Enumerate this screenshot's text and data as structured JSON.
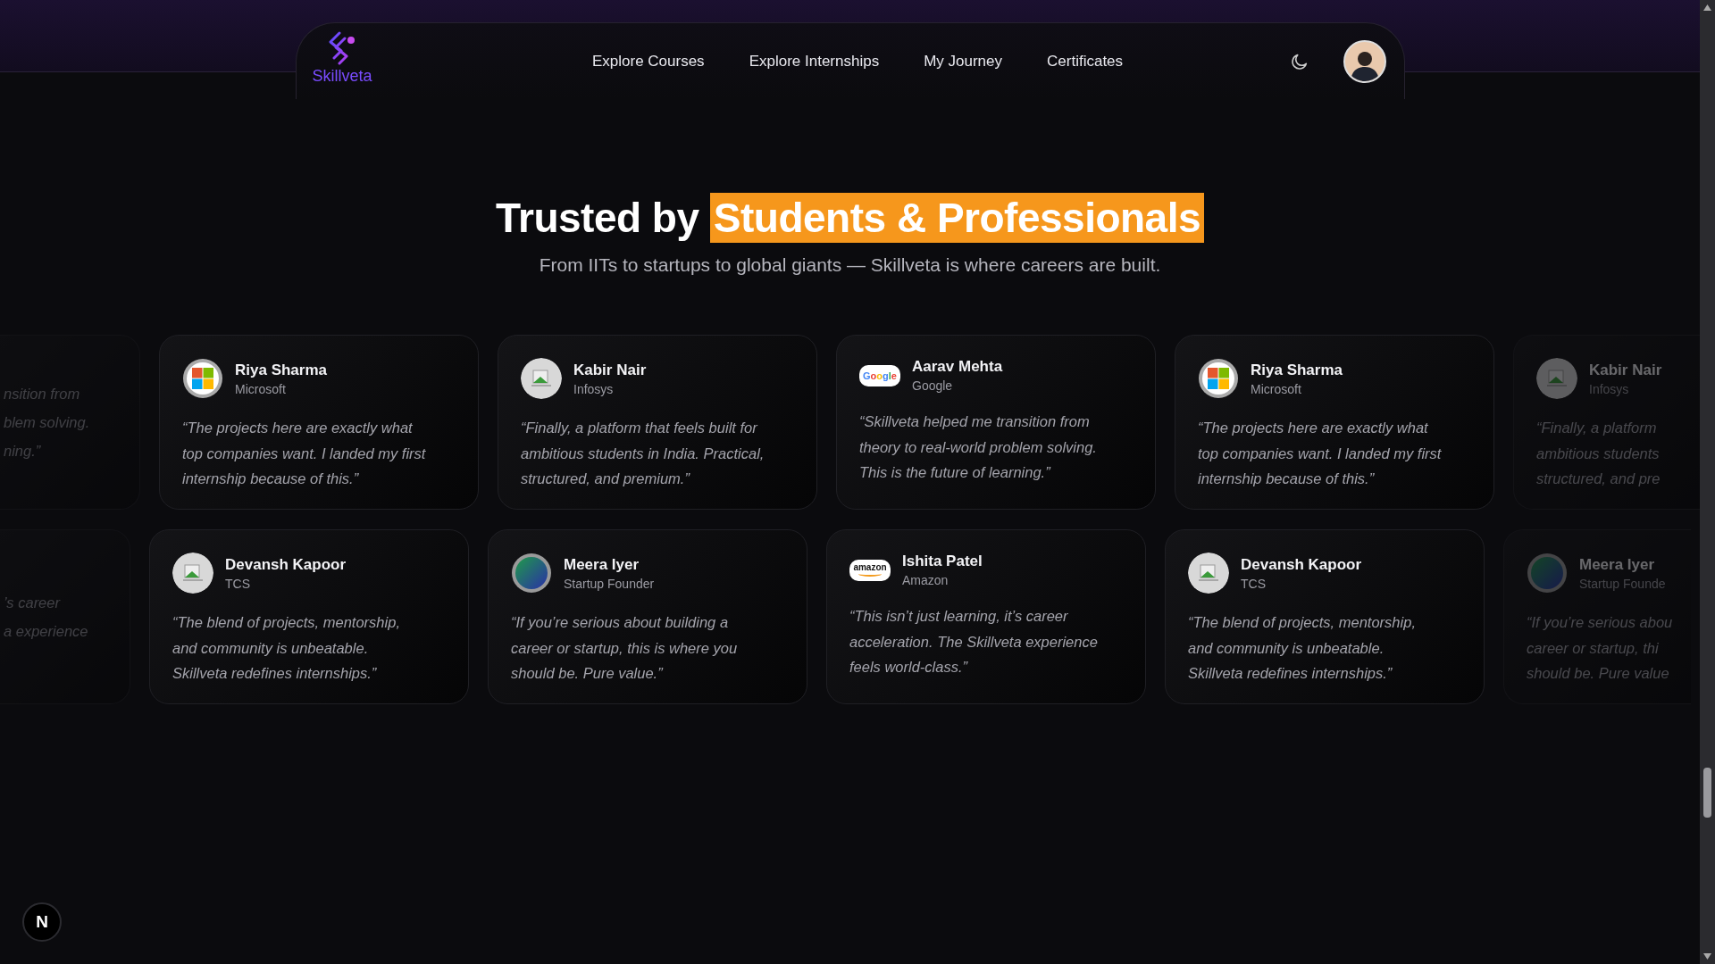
{
  "brand": {
    "name": "Skillveta"
  },
  "nav": {
    "links": [
      {
        "label": "Explore Courses"
      },
      {
        "label": "Explore Internships"
      },
      {
        "label": "My Journey"
      },
      {
        "label": "Certificates"
      }
    ]
  },
  "hero": {
    "lead": "Trusted by",
    "highlight": "Students & Professionals",
    "subtitle": "From IITs to startups to global giants — Skillveta is where careers are built."
  },
  "rows": [
    {
      "cards": [
        {
          "kind": "partial-left",
          "quote_lines": [
            "nsition from",
            "blem solving.",
            "ning.”"
          ]
        },
        {
          "kind": "full",
          "name": "Riya Sharma",
          "company": "Microsoft",
          "logo": {
            "kind": "microsoft"
          },
          "quote_lines": [
            "“The projects here are exactly what",
            "top companies want. I landed my first",
            "internship because of this.”"
          ]
        },
        {
          "kind": "full",
          "name": "Kabir Nair",
          "company": "Infosys",
          "logo": {
            "kind": "broken-image"
          },
          "quote_lines": [
            "“Finally, a platform that feels built for",
            "ambitious students in India. Practical,",
            "structured, and premium.”"
          ]
        },
        {
          "kind": "full",
          "name": "Aarav Mehta",
          "company": "Google",
          "logo": {
            "kind": "google",
            "text": "Google"
          },
          "quote_lines": [
            "“Skillveta helped me transition from",
            "theory to real-world problem solving.",
            "This is the future of learning.”"
          ]
        },
        {
          "kind": "full",
          "name": "Riya Sharma",
          "company": "Microsoft",
          "logo": {
            "kind": "microsoft"
          },
          "quote_lines": [
            "“The projects here are exactly what",
            "top companies want. I landed my first",
            "internship because of this.”"
          ]
        },
        {
          "kind": "partial-right",
          "name": "Kabir Nair",
          "company": "Infosys",
          "logo": {
            "kind": "broken-image"
          },
          "quote_lines": [
            "“Finally, a platform",
            "ambitious students",
            "structured, and pre"
          ]
        }
      ]
    },
    {
      "cards": [
        {
          "kind": "partial-left",
          "quote_lines": [
            "’s career",
            "a experience"
          ]
        },
        {
          "kind": "full",
          "name": "Devansh Kapoor",
          "company": "TCS",
          "logo": {
            "kind": "broken-image"
          },
          "quote_lines": [
            "“The blend of projects, mentorship,",
            "and community is unbeatable.",
            "Skillveta redefines internships.”"
          ]
        },
        {
          "kind": "full",
          "name": "Meera Iyer",
          "company": "Startup Founder",
          "logo": {
            "kind": "gradient-circle"
          },
          "quote_lines": [
            "“If you’re serious about building a",
            "career or startup, this is where you",
            "should be. Pure value.”"
          ]
        },
        {
          "kind": "full",
          "name": "Ishita Patel",
          "company": "Amazon",
          "logo": {
            "kind": "amazon",
            "text": "amazon"
          },
          "quote_lines": [
            "“This isn’t just learning, it’s career",
            "acceleration. The Skillveta experience",
            "feels world-class.”"
          ]
        },
        {
          "kind": "full",
          "name": "Devansh Kapoor",
          "company": "TCS",
          "logo": {
            "kind": "broken-image"
          },
          "quote_lines": [
            "“The blend of projects, mentorship,",
            "and community is unbeatable.",
            "Skillveta redefines internships.”"
          ]
        },
        {
          "kind": "partial-right",
          "name": "Meera Iyer",
          "company": "Startup Founde",
          "logo": {
            "kind": "gradient-circle"
          },
          "quote_lines": [
            "“If you’re serious abou",
            "career or startup, thi",
            "should be. Pure value"
          ]
        }
      ]
    }
  ],
  "dev_badge": {
    "letter": "N"
  }
}
